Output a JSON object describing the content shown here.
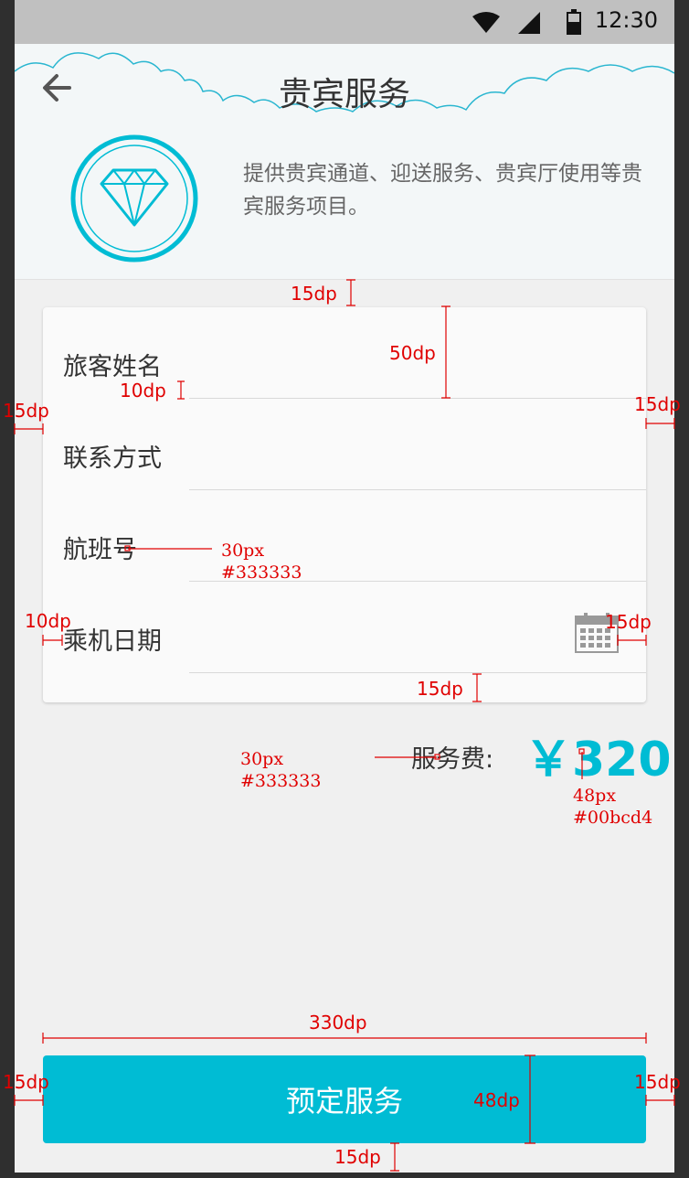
{
  "status_bar": {
    "time": "12:30",
    "icons": [
      "wifi-icon",
      "signal-icon",
      "battery-icon"
    ]
  },
  "header": {
    "title": "贵宾服务",
    "description": "提供贵宾通道、迎送服务、贵宾厅使用等贵宾服务项目。",
    "logo_icon": "diamond-icon"
  },
  "form": {
    "fields": [
      {
        "label": "旅客姓名",
        "value": "",
        "placeholder": ""
      },
      {
        "label": "联系方式",
        "value": "",
        "placeholder": ""
      },
      {
        "label": "航班号",
        "value": "",
        "placeholder": ""
      },
      {
        "label": "乘机日期",
        "value": "",
        "placeholder": "",
        "icon": "calendar-icon"
      }
    ]
  },
  "fee": {
    "label": "服务费:",
    "value": "￥320"
  },
  "action": {
    "book_label": "预定服务"
  },
  "annotations": {
    "card_top_gap": "15dp",
    "row_height": "50dp",
    "label_bottom_gap": "10dp",
    "card_left_margin": "15dp",
    "card_right_margin": "15dp",
    "label_font_size": "30px",
    "label_color": "#333333",
    "label_left_padding": "10dp",
    "icon_right_padding": "15dp",
    "card_bottom_padding": "15dp",
    "fee_label_font_size": "30px",
    "fee_label_color": "#333333",
    "fee_value_font_size": "48px",
    "fee_value_color": "#00bcd4",
    "button_width": "330dp",
    "button_left_margin": "15dp",
    "button_height": "48dp",
    "button_right_margin": "15dp",
    "button_bottom_margin": "15dp"
  },
  "colors": {
    "accent": "#00bcd4",
    "text": "#333333",
    "annotation": "#e00000"
  }
}
